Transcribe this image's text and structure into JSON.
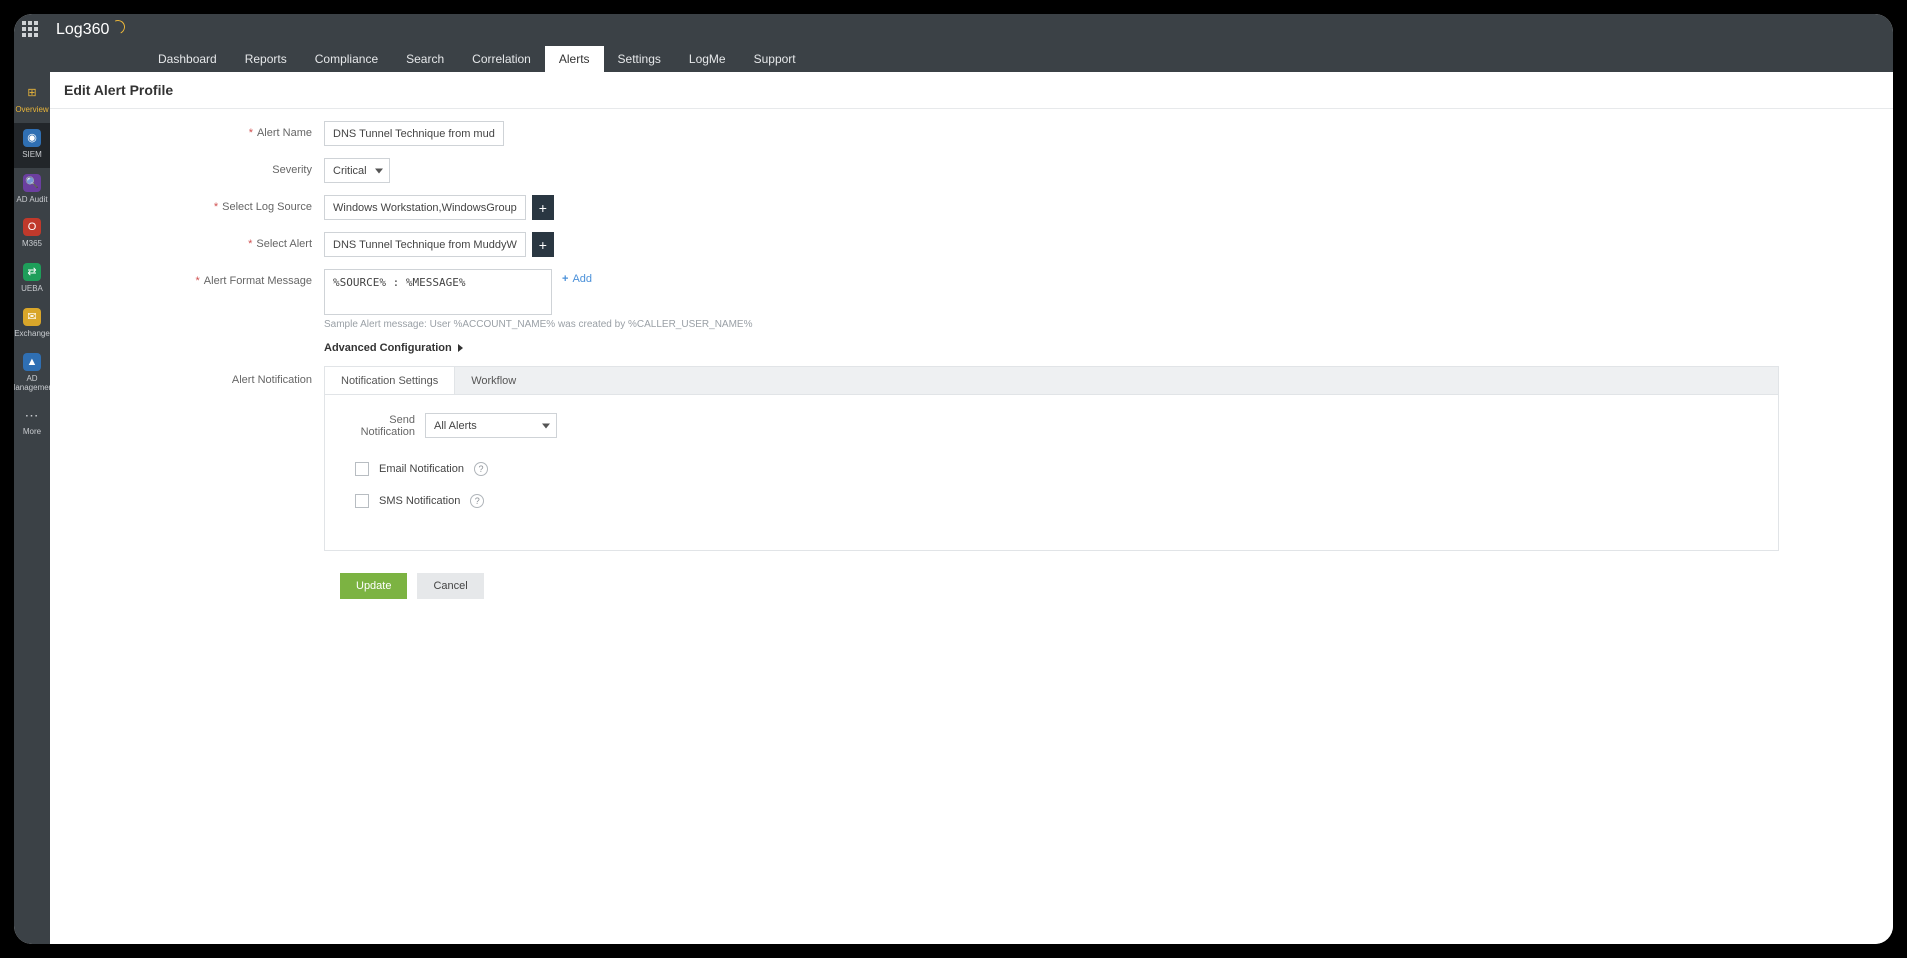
{
  "brand": "Log360",
  "top_tabs": [
    "Dashboard",
    "Reports",
    "Compliance",
    "Search",
    "Correlation",
    "Alerts",
    "Settings",
    "LogMe",
    "Support"
  ],
  "top_tabs_active_index": 5,
  "sidebar": [
    {
      "label": "Overview",
      "key": "overview",
      "iconClass": "grid",
      "glyph": "⊞"
    },
    {
      "label": "SIEM",
      "key": "siem",
      "iconClass": "blue",
      "glyph": "◉"
    },
    {
      "label": "AD Audit",
      "key": "ad-audit",
      "iconClass": "purple",
      "glyph": "🔍"
    },
    {
      "label": "M365",
      "key": "m365",
      "iconClass": "red",
      "glyph": "O"
    },
    {
      "label": "UEBA",
      "key": "ueba",
      "iconClass": "green",
      "glyph": "⇄"
    },
    {
      "label": "Exchange",
      "key": "exchange",
      "iconClass": "yellow",
      "glyph": "✉"
    },
    {
      "label": "AD Management",
      "key": "ad-management",
      "iconClass": "blue2",
      "glyph": "▲"
    },
    {
      "label": "More",
      "key": "more",
      "iconClass": "more",
      "glyph": "⋯"
    }
  ],
  "sidebar_active_index": 1,
  "page_title": "Edit Alert Profile",
  "form": {
    "labels": {
      "alert_name": "Alert Name",
      "severity": "Severity",
      "select_log_source": "Select Log Source",
      "select_alert": "Select Alert",
      "alert_format_message": "Alert Format Message",
      "alert_notification": "Alert Notification"
    },
    "alert_name_value": "DNS Tunnel Technique from muddy water",
    "severity_selected": "Critical",
    "log_source_value": "Windows Workstation,WindowsGroup",
    "select_alert_value": "DNS Tunnel Technique from MuddyW",
    "alert_format_value": "%SOURCE% : %MESSAGE%",
    "add_link": "Add",
    "sample_hint": "Sample Alert message: User %ACCOUNT_NAME% was created by %CALLER_USER_NAME%",
    "advanced_label": "Advanced Configuration"
  },
  "notification": {
    "subtabs": [
      "Notification Settings",
      "Workflow"
    ],
    "subtabs_active_index": 0,
    "send_notification_label": "Send Notification",
    "send_notification_selected": "All Alerts",
    "email_label": "Email Notification",
    "sms_label": "SMS Notification"
  },
  "buttons": {
    "update": "Update",
    "cancel": "Cancel"
  }
}
